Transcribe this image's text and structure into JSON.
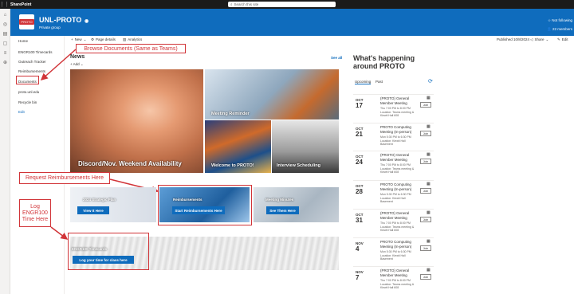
{
  "suite": {
    "app_name": "SharePoint",
    "search_placeholder": "Search this site"
  },
  "site": {
    "logo_text": "PROTO",
    "title": "UNL-PROTO",
    "subtitle": "Private group",
    "follow_label": "Not following",
    "members_label": "22 members"
  },
  "nav": {
    "items": [
      "Home",
      "ENGR100 Timecards",
      "Outreach Tracker",
      "Reimbursements",
      "Documents",
      "proto.unl.edu",
      "Recycle bin",
      "Edit"
    ]
  },
  "commands": {
    "new": "New",
    "page_details": "Page details",
    "analytics": "Analytics",
    "published": "Published 10/8/2024",
    "share": "Share",
    "edit": "Edit"
  },
  "news": {
    "title": "News",
    "add": "Add",
    "see_all": "See all",
    "tiles": [
      "Discord/Nov. Weekend Availability",
      "Meeting Reminder",
      "Welcome to PROTO!",
      "Interview Scheduling"
    ]
  },
  "quicklinks": {
    "strategic_plan": "2024 Strategic Plan",
    "view_it_here": "View It Here",
    "reimbursements": "Reimbursements",
    "start_reimb": "Start Reimbursements Here",
    "meeting_minutes": "Meeting Minutes",
    "see_them_here": "See Them Here",
    "timecards": "ENGR100 Timecards",
    "log_time": "Log your time for class here"
  },
  "annotations": {
    "browse": "Browse Documents (Same as Teams)",
    "reimb": "Request Reimbursements Here",
    "log": "Log ENGR100 Time Here"
  },
  "events": {
    "title": "What's happening around PROTO",
    "tab_upcoming": "Upcoming",
    "tab_past": "Past",
    "join": "Join",
    "items": [
      {
        "month": "OCT",
        "day": "17",
        "title": "(PROTO) General Member Meeting",
        "detail": "Thu 7:00 PM to 8:00 PM Location: Teams meeting & Kiewit Hall 608"
      },
      {
        "month": "OCT",
        "day": "21",
        "title": "PROTO Computing Meeting (In-person)",
        "detail": "Mon 5:30 PM to 6:30 PM Location: Kiewit Hall Basement"
      },
      {
        "month": "OCT",
        "day": "24",
        "title": "(PROTO) General Member Meeting",
        "detail": "Thu 7:00 PM to 8:00 PM Location: Teams meeting & Kiewit Hall 608"
      },
      {
        "month": "OCT",
        "day": "28",
        "title": "PROTO Computing Meeting (In-person)",
        "detail": "Mon 5:30 PM to 6:30 PM Location: Kiewit Hall Basement"
      },
      {
        "month": "OCT",
        "day": "31",
        "title": "(PROTO) General Member Meeting",
        "detail": "Thu 7:00 PM to 8:00 PM Location: Teams meeting & Kiewit Hall 608"
      },
      {
        "month": "NOV",
        "day": "4",
        "title": "PROTO Computing Meeting (In-person)",
        "detail": "Mon 5:30 PM to 6:30 PM Location: Kiewit Hall Basement"
      },
      {
        "month": "NOV",
        "day": "7",
        "title": "(PROTO) General Member Meeting",
        "detail": "Thu 7:00 PM to 8:00 PM Location: Teams meeting & Kiewit Hall 608"
      }
    ]
  },
  "colors": {
    "brand": "#0f6cbd",
    "annotation": "#d13438"
  }
}
